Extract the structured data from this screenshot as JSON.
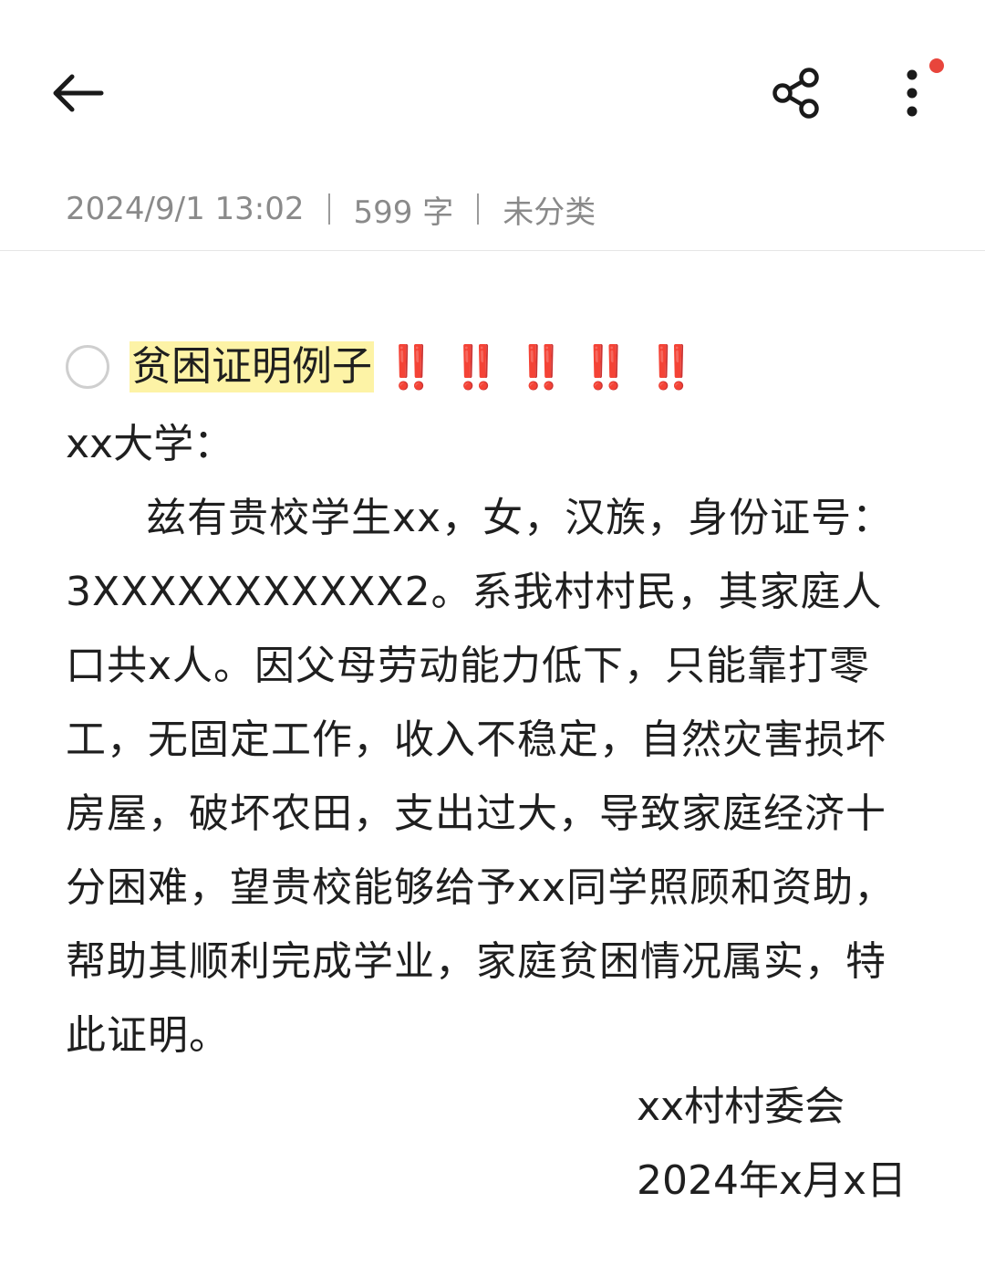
{
  "toolbar": {
    "back_icon": "arrow-left-icon",
    "share_icon": "share-icon",
    "more_icon": "more-vertical-icon",
    "badge_color": "#e8453c"
  },
  "meta": {
    "datetime": "2024/9/1 13:02",
    "word_count": "599 字",
    "category": "未分类"
  },
  "note": {
    "title": "贫困证明例子",
    "title_highlight_color": "#fdf3a6",
    "emphasis": "‼️‼️‼️‼️‼️",
    "salutation": "xx大学：",
    "body": "兹有贵校学生xx，女，汉族，身份证号：3XXXXXXXXXXX2。系我村村民，其家庭人口共x人。因父母劳动能力低下，只能靠打零工，无固定工作，收入不稳定，自然灾害损坏房屋，破坏农田，支出过大，导致家庭经济十分困难，望贵校能够给予xx同学照顾和资助，帮助其顺利完成学业，家庭贫困情况属实，特此证明。",
    "signature": "xx村村委会",
    "date": "2024年x月x日"
  }
}
